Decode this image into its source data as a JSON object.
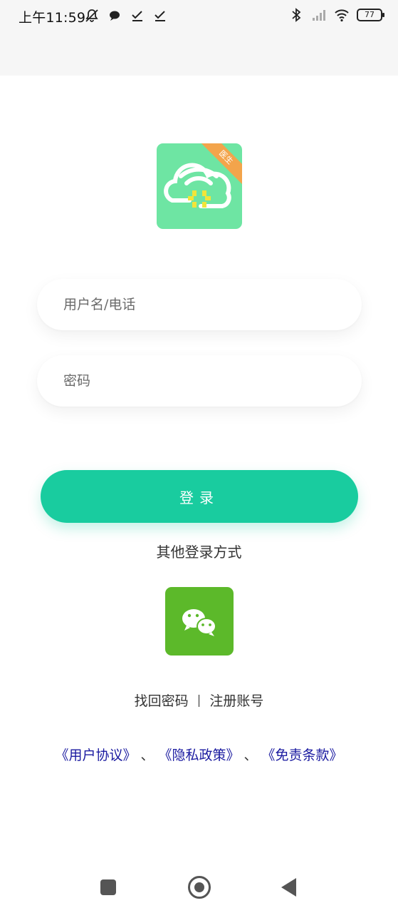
{
  "status_bar": {
    "time": "上午11:59",
    "battery": "77",
    "left_icons": [
      "mute-icon",
      "chat-bubble-icon",
      "check-icon",
      "check-icon"
    ],
    "right_icons": [
      "bluetooth-icon",
      "signal-icon",
      "wifi-icon"
    ]
  },
  "logo": {
    "badge": "医生",
    "colors": {
      "background": "#6ee5a3",
      "ribbon": "#f3a44b",
      "cross": "#f2e53a"
    }
  },
  "form": {
    "username_placeholder": "用户名/电话",
    "password_placeholder": "密码"
  },
  "login_button": {
    "label": "登录",
    "color": "#19cc9f"
  },
  "other_login": {
    "label": "其他登录方式",
    "wechat_icon": "wechat-icon",
    "wechat_color": "#5cb92a"
  },
  "links": {
    "recover_password": "找回密码",
    "separator": "|",
    "register": "注册账号"
  },
  "agreements": {
    "user_agreement": "《用户协议》",
    "privacy_policy": "《隐私政策》",
    "disclaimer": "《免责条款》",
    "separator": "、",
    "color": "#1a1aa0"
  },
  "nav_bar": {
    "buttons": [
      "recent-apps-icon",
      "home-icon",
      "back-icon"
    ]
  }
}
